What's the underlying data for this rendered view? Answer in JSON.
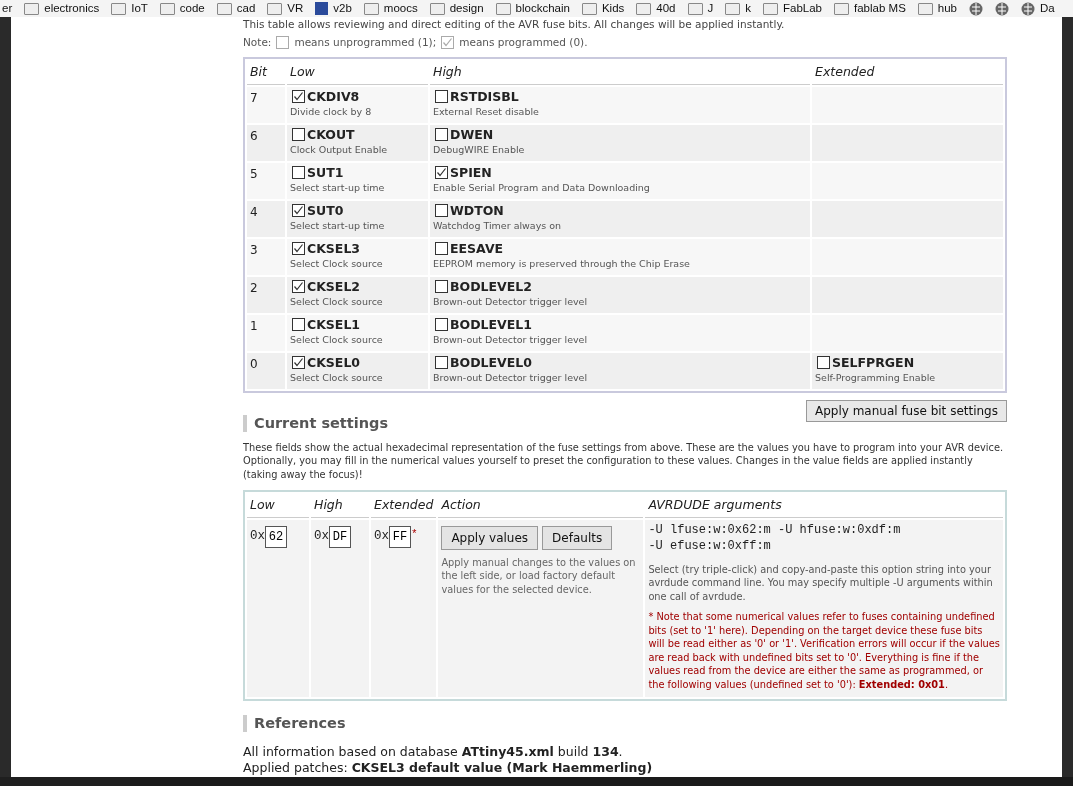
{
  "bookmarks": [
    {
      "label": "er",
      "kind": "none"
    },
    {
      "label": "electronics",
      "kind": "folder"
    },
    {
      "label": "IoT",
      "kind": "folder"
    },
    {
      "label": "code",
      "kind": "folder"
    },
    {
      "label": "cad",
      "kind": "folder"
    },
    {
      "label": "VR",
      "kind": "folder"
    },
    {
      "label": "v2b",
      "kind": "site"
    },
    {
      "label": "moocs",
      "kind": "folder"
    },
    {
      "label": "design",
      "kind": "folder"
    },
    {
      "label": "blockchain",
      "kind": "folder"
    },
    {
      "label": "Kids",
      "kind": "folder"
    },
    {
      "label": "40d",
      "kind": "folder"
    },
    {
      "label": "J",
      "kind": "folder"
    },
    {
      "label": "k",
      "kind": "folder"
    },
    {
      "label": "FabLab",
      "kind": "folder"
    },
    {
      "label": "fablab MS",
      "kind": "folder"
    },
    {
      "label": "hub",
      "kind": "folder"
    },
    {
      "kind": "globe"
    },
    {
      "kind": "globe"
    },
    {
      "label": "Da",
      "kind": "globe"
    }
  ],
  "intro": "This table allows reviewing and direct editing of the AVR fuse bits. All changes will be applied instantly.",
  "note": {
    "label": "Note:",
    "items": [
      {
        "checked": false,
        "text": "means unprogrammed (1);"
      },
      {
        "checked": true,
        "text": "means programmed (0)."
      }
    ]
  },
  "fuse_table": {
    "columns": [
      "Bit",
      "Low",
      "High",
      "Extended"
    ],
    "rows": [
      {
        "bit": "7",
        "low": {
          "name": "CKDIV8",
          "description": "Divide clock by 8",
          "checked": true
        },
        "high": {
          "name": "RSTDISBL",
          "description": "External Reset disable",
          "checked": false
        }
      },
      {
        "bit": "6",
        "low": {
          "name": "CKOUT",
          "description": "Clock Output Enable",
          "checked": false
        },
        "high": {
          "name": "DWEN",
          "description": "DebugWIRE Enable",
          "checked": false
        }
      },
      {
        "bit": "5",
        "low": {
          "name": "SUT1",
          "description": "Select start-up time",
          "checked": false
        },
        "high": {
          "name": "SPIEN",
          "description": "Enable Serial Program and Data Downloading",
          "checked": true
        }
      },
      {
        "bit": "4",
        "low": {
          "name": "SUT0",
          "description": "Select start-up time",
          "checked": true
        },
        "high": {
          "name": "WDTON",
          "description": "Watchdog Timer always on",
          "checked": false
        }
      },
      {
        "bit": "3",
        "low": {
          "name": "CKSEL3",
          "description": "Select Clock source",
          "checked": true
        },
        "high": {
          "name": "EESAVE",
          "description": "EEPROM memory is preserved through the Chip Erase",
          "checked": false
        }
      },
      {
        "bit": "2",
        "low": {
          "name": "CKSEL2",
          "description": "Select Clock source",
          "checked": true
        },
        "high": {
          "name": "BODLEVEL2",
          "description": "Brown-out Detector trigger level",
          "checked": false
        }
      },
      {
        "bit": "1",
        "low": {
          "name": "CKSEL1",
          "description": "Select Clock source",
          "checked": false
        },
        "high": {
          "name": "BODLEVEL1",
          "description": "Brown-out Detector trigger level",
          "checked": false
        }
      },
      {
        "bit": "0",
        "low": {
          "name": "CKSEL0",
          "description": "Select Clock source",
          "checked": true
        },
        "high": {
          "name": "BODLEVEL0",
          "description": "Brown-out Detector trigger level",
          "checked": false
        },
        "extended": {
          "name": "SELFPRGEN",
          "description": "Self-Programming Enable",
          "checked": false
        }
      }
    ]
  },
  "apply_button": "Apply manual fuse bit settings",
  "current_settings": {
    "heading": "Current settings",
    "description": "These fields show the actual hexadecimal representation of the fuse settings from above. These are the values you have to program into your AVR device. Optionally, you may fill in the numerical values yourself to preset the configuration to these values. Changes in the value fields are applied instantly (taking away the focus)!",
    "columns": [
      "Low",
      "High",
      "Extended",
      "Action",
      "AVRDUDE arguments"
    ],
    "fields": [
      {
        "prefix": "0x",
        "value": "62"
      },
      {
        "prefix": "0x",
        "value": "DF"
      },
      {
        "prefix": "0x",
        "value": "FF",
        "mark": "*"
      }
    ],
    "buttons": [
      "Apply values",
      "Defaults"
    ],
    "action_help": "Apply manual changes to the values on the left side, or load factory default values for the selected device.",
    "avrdude_args": [
      "-U lfuse:w:0x62:m -U hfuse:w:0xdf:m",
      "-U efuse:w:0xff:m"
    ],
    "avrdude_help": "Select (try triple-click) and copy-and-paste this option string into your avrdude command line. You may specify multiple -U arguments within one call of avrdude.",
    "footnote": "* Note that some numerical values refer to fuses containing undefined bits (set to '1' here). Depending on the target device these fuse bits will be read either as '0' or '1'. Verification errors will occur if the values are read back with undefined bits set to '0'. Everything is fine if the values read from the device are either the same as programmed, or the following values (undefined set to '0'): **Extended: 0x01**."
  },
  "references": {
    "heading": "References",
    "lines": [
      "All information based on database **ATtiny45.xml** build **134**.",
      "Applied patches: **CKSEL3 default value (Mark Haemmerling)**"
    ]
  }
}
